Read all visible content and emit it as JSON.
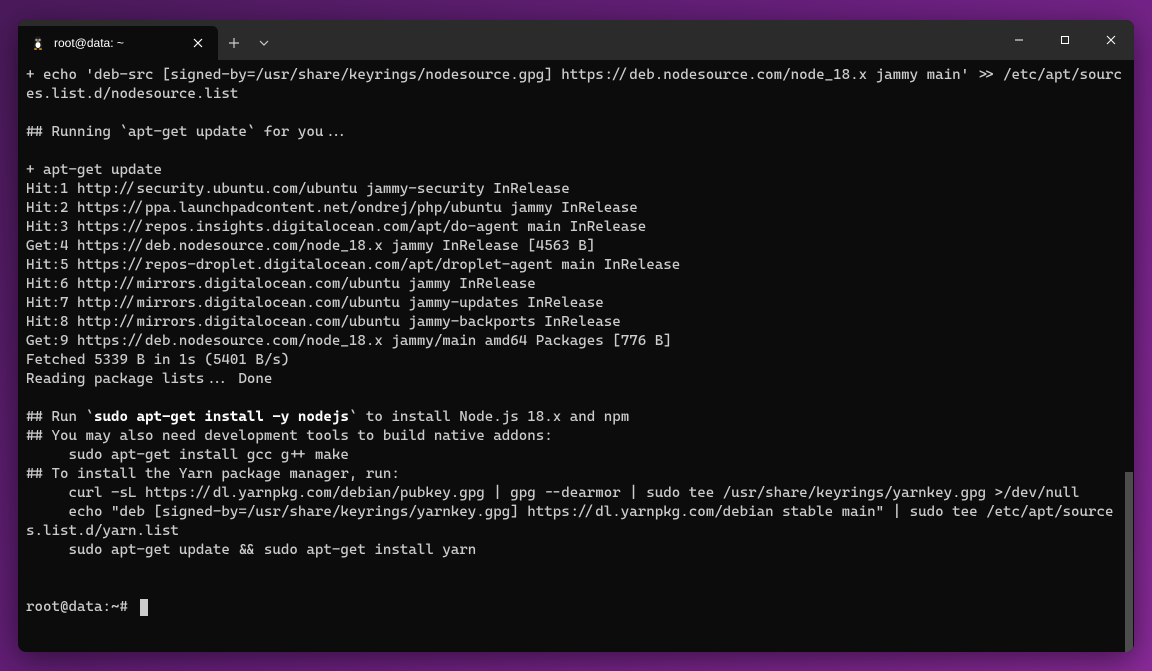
{
  "tab": {
    "title": "root@data: ~"
  },
  "terminal": {
    "lines": [
      {
        "text": "+ echo 'deb-src [signed-by=/usr/share/keyrings/nodesource.gpg] https://deb.nodesource.com/node_18.x jammy main' >> /etc/apt/sources.list.d/nodesource.list"
      },
      {
        "text": ""
      },
      {
        "text": "## Running `apt-get update` for you..."
      },
      {
        "text": ""
      },
      {
        "text": "+ apt-get update"
      },
      {
        "text": "Hit:1 http://security.ubuntu.com/ubuntu jammy-security InRelease"
      },
      {
        "text": "Hit:2 https://ppa.launchpadcontent.net/ondrej/php/ubuntu jammy InRelease"
      },
      {
        "text": "Hit:3 https://repos.insights.digitalocean.com/apt/do-agent main InRelease"
      },
      {
        "text": "Get:4 https://deb.nodesource.com/node_18.x jammy InRelease [4563 B]"
      },
      {
        "text": "Hit:5 https://repos-droplet.digitalocean.com/apt/droplet-agent main InRelease"
      },
      {
        "text": "Hit:6 http://mirrors.digitalocean.com/ubuntu jammy InRelease"
      },
      {
        "text": "Hit:7 http://mirrors.digitalocean.com/ubuntu jammy-updates InRelease"
      },
      {
        "text": "Hit:8 http://mirrors.digitalocean.com/ubuntu jammy-backports InRelease"
      },
      {
        "text": "Get:9 https://deb.nodesource.com/node_18.x jammy/main amd64 Packages [776 B]"
      },
      {
        "text": "Fetched 5339 B in 1s (5401 B/s)"
      },
      {
        "text": "Reading package lists... Done"
      },
      {
        "text": ""
      }
    ],
    "run_prefix": "## Run `",
    "run_bold": "sudo apt-get install -y nodejs",
    "run_suffix": "` to install Node.js 18.x and npm",
    "addon_lines": [
      "## You may also need development tools to build native addons:",
      "     sudo apt-get install gcc g++ make",
      "## To install the Yarn package manager, run:",
      "     curl -sL https://dl.yarnpkg.com/debian/pubkey.gpg | gpg --dearmor | sudo tee /usr/share/keyrings/yarnkey.gpg >/dev/null",
      "     echo \"deb [signed-by=/usr/share/keyrings/yarnkey.gpg] https://dl.yarnpkg.com/debian stable main\" | sudo tee /etc/apt/sources.list.d/yarn.list",
      "     sudo apt-get update && sudo apt-get install yarn",
      "",
      ""
    ],
    "prompt": "root@data:~# "
  }
}
